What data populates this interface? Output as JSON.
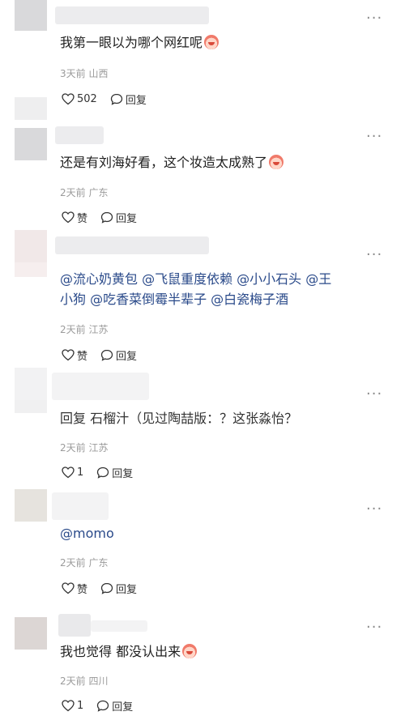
{
  "comments": [
    {
      "text": "我第一眼以为哪个网红呢",
      "time": "3天前",
      "location": "山西",
      "like_label": "502",
      "reply_label": "回复"
    },
    {
      "text": "还是有刘海好看，这个妆造太成熟了",
      "time": "2天前",
      "location": "广东",
      "like_label": "赞",
      "reply_label": "回复"
    },
    {
      "line1": "@流心奶黄包 @飞鼠重度依赖 @小小石头 @王",
      "line2": "小狗 @吃香菜倒霉半辈子 @白瓷梅子酒",
      "time": "2天前",
      "location": "江苏",
      "like_label": "赞",
      "reply_label": "回复"
    },
    {
      "text": "回复 石榴汁（见过陶喆版：？这张淼怡？",
      "time": "2天前",
      "location": "江苏",
      "like_label": "1",
      "reply_label": "回复"
    },
    {
      "text": "@momo",
      "time": "2天前",
      "location": "广东",
      "like_label": "赞",
      "reply_label": "回复"
    },
    {
      "text": "我也觉得 都没认出来",
      "time": "2天前",
      "location": "四川",
      "like_label": "1",
      "reply_label": "回复"
    }
  ],
  "more_label": "···",
  "icons": {
    "like": "heart-outline-icon",
    "reply": "speech-bubble-icon",
    "more": "more-dots-icon",
    "emoji": "clown-face-emoji-icon"
  }
}
